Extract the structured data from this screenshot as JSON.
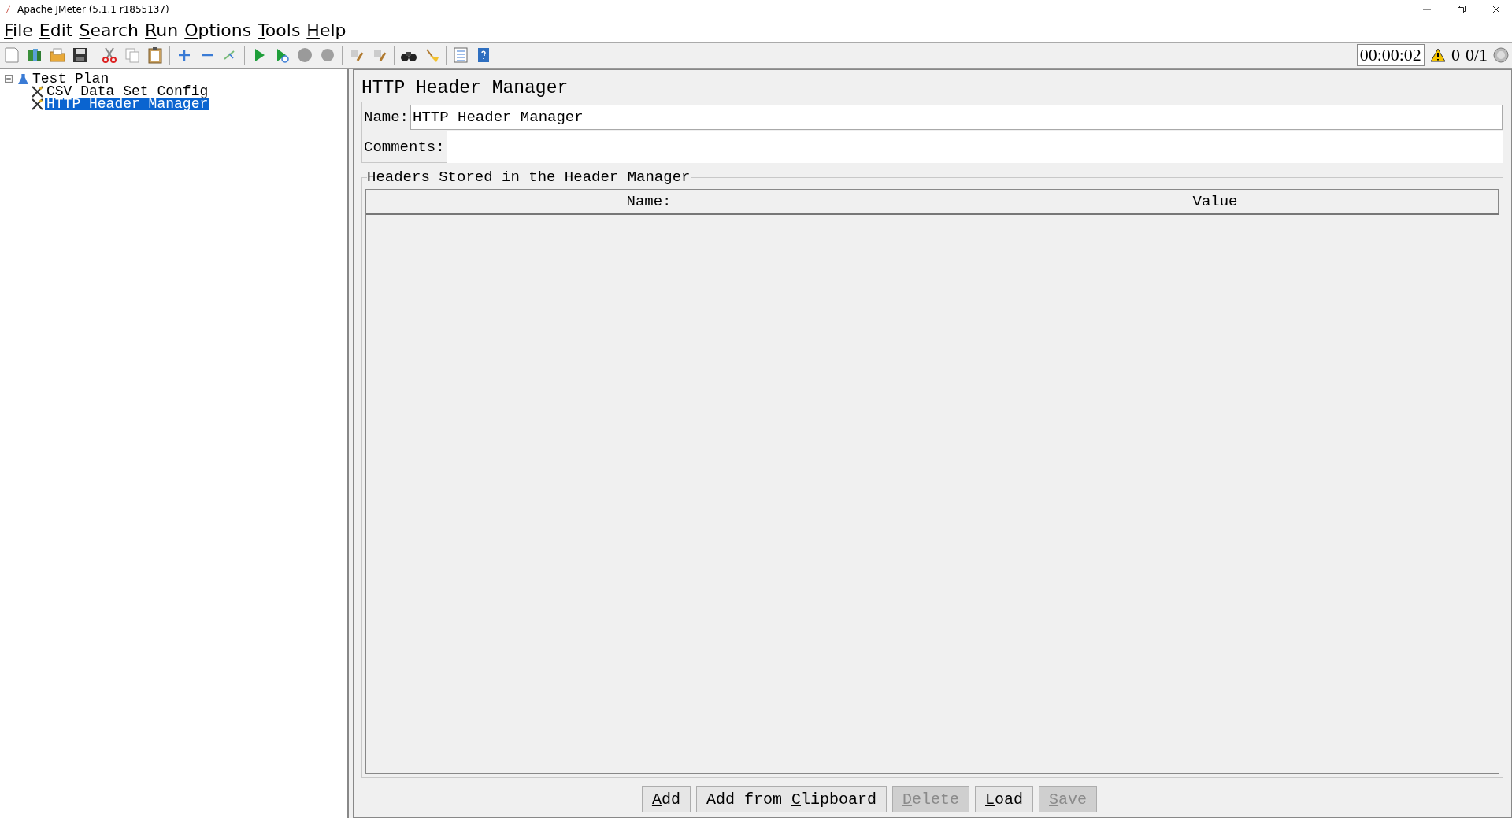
{
  "window": {
    "title": "Apache JMeter (5.1.1 r1855137)"
  },
  "menu": [
    {
      "key": "F",
      "rest": "ile"
    },
    {
      "key": "E",
      "rest": "dit"
    },
    {
      "key": "S",
      "rest": "earch"
    },
    {
      "key": "R",
      "rest": "un"
    },
    {
      "key": "O",
      "rest": "ptions"
    },
    {
      "key": "T",
      "rest": "ools"
    },
    {
      "key": "H",
      "rest": "elp"
    }
  ],
  "status": {
    "timer": "00:00:02",
    "warnings": "0",
    "threads": "0/1"
  },
  "tree": [
    {
      "label": "Test Plan",
      "kind": "plan",
      "selected": false,
      "expanded": true,
      "children": [
        {
          "label": "CSV Data Set Config",
          "kind": "config",
          "selected": false
        },
        {
          "label": "HTTP Header Manager",
          "kind": "config",
          "selected": true
        }
      ]
    }
  ],
  "editor": {
    "title": "HTTP Header Manager",
    "name_label": "Name:",
    "name_value": "HTTP Header Manager",
    "comments_label": "Comments:",
    "group_title": "Headers Stored in the Header Manager",
    "columns": [
      "Name:",
      "Value"
    ],
    "buttons": [
      {
        "key": "A",
        "rest": "dd",
        "disabled": false
      },
      {
        "before": "Add from ",
        "key": "C",
        "rest": "lipboard",
        "disabled": false
      },
      {
        "key": "D",
        "rest": "elete",
        "disabled": true
      },
      {
        "key": "L",
        "rest": "oad",
        "disabled": false
      },
      {
        "key": "S",
        "rest": "ave",
        "disabled": true
      }
    ]
  }
}
